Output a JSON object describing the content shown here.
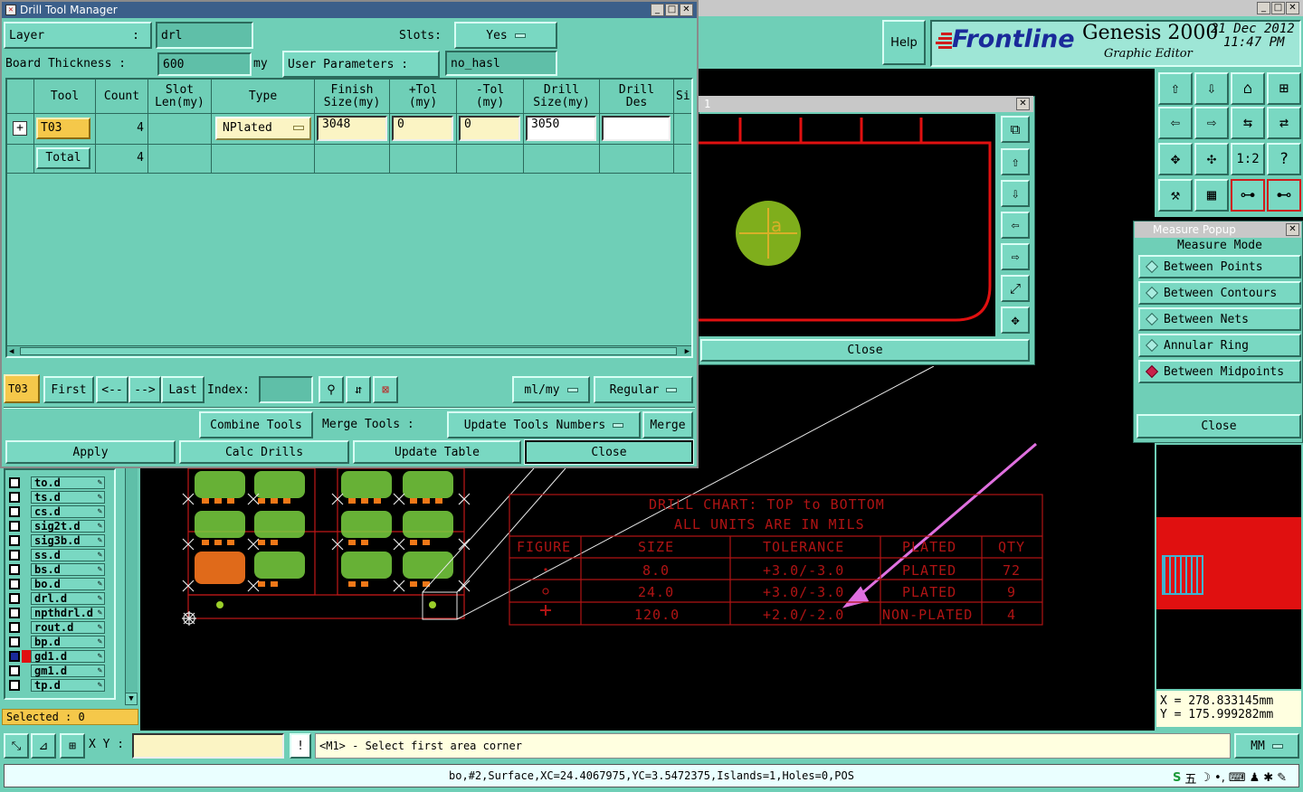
{
  "drill_tool_manager": {
    "title": "Drill Tool Manager",
    "layer_label": "Layer",
    "layer_colon": ":",
    "layer_value": "drl",
    "slots_label": "Slots:",
    "slots_value": "Yes",
    "board_thickness_label": "Board Thickness :",
    "board_thickness_value": "600",
    "board_thickness_unit": "my",
    "user_params_label": "User Parameters :",
    "user_params_value": "no_hasl",
    "columns": [
      "Tool",
      "Count",
      "Slot\nLen(my)",
      "Type",
      "Finish\nSize(my)",
      "+Tol\n(my)",
      "-Tol\n(my)",
      "Drill\nSize(my)",
      "Drill\nDes",
      "Si"
    ],
    "row": {
      "tool": "T03",
      "count": "4",
      "type": "NPlated",
      "finish": "3048",
      "ptol": "0",
      "mtol": "0",
      "drill": "3050",
      "des": ""
    },
    "total": {
      "label": "Total",
      "count": "4"
    },
    "nav": {
      "current": "T03",
      "first": "First",
      "prev": "<--",
      "next": "-->",
      "last": "Last",
      "index_label": "Index:",
      "units": "ml/my",
      "mode": "Regular"
    },
    "actions": {
      "combine": "Combine Tools",
      "merge_tools": "Merge Tools :",
      "update_numbers": "Update Tools Numbers",
      "merge": "Merge"
    },
    "bottom": {
      "apply": "Apply",
      "calc": "Calc Drills",
      "update": "Update Table",
      "close": "Close"
    }
  },
  "editor": {
    "help": "Help",
    "brand": "Frontline",
    "product": "Genesis 2000",
    "subtitle": "Graphic Editor",
    "date": "21 Dec 2012",
    "time": "11:47 PM"
  },
  "zoom_window": {
    "number": "1",
    "close": "Close"
  },
  "measure": {
    "title": "Measure Popup",
    "mode_label": "Measure Mode",
    "options": [
      "Between Points",
      "Between Contours",
      "Between Nets",
      "Annular Ring",
      "Between Midpoints"
    ],
    "selected": "Between Midpoints",
    "close": "Close"
  },
  "layers": {
    "items": [
      "to.d",
      "ts.d",
      "cs.d",
      "sig2t.d",
      "sig3b.d",
      "ss.d",
      "bs.d",
      "bo.d",
      "drl.d",
      "npthdrl.d",
      "rout.d",
      "bp.d",
      "gd1.d",
      "gm1.d",
      "tp.d"
    ],
    "selected": "Selected : 0"
  },
  "drill_chart": {
    "title1": "DRILL CHART: TOP to BOTTOM",
    "title2": "ALL UNITS ARE IN MILS",
    "headers": [
      "FIGURE",
      "SIZE",
      "TOLERANCE",
      "PLATED",
      "QTY"
    ],
    "rows": [
      {
        "size": "8.0",
        "tol": "+3.0/-3.0",
        "plated": "PLATED",
        "qty": "72"
      },
      {
        "size": "24.0",
        "tol": "+3.0/-3.0",
        "plated": "PLATED",
        "qty": "9"
      },
      {
        "size": "120.0",
        "tol": "+2.0/-2.0",
        "plated": "NON-PLATED",
        "qty": "4"
      }
    ]
  },
  "coords": {
    "x": "X = 278.833145mm",
    "y": "Y = 175.999282mm"
  },
  "bottom_bar": {
    "xy_label": "X Y :",
    "prompt": "<M1> - Select first area corner",
    "units": "MM",
    "status": "bo,#2,Surface,XC=24.4067975,YC=3.5472375,Islands=1,Holes=0,POS"
  },
  "colors": {
    "teal": "#6fcfb7",
    "panel_red": "#e01010",
    "chart_red": "#b01414",
    "arrow": "#e070e0",
    "pad_green": "#7fae1c"
  }
}
